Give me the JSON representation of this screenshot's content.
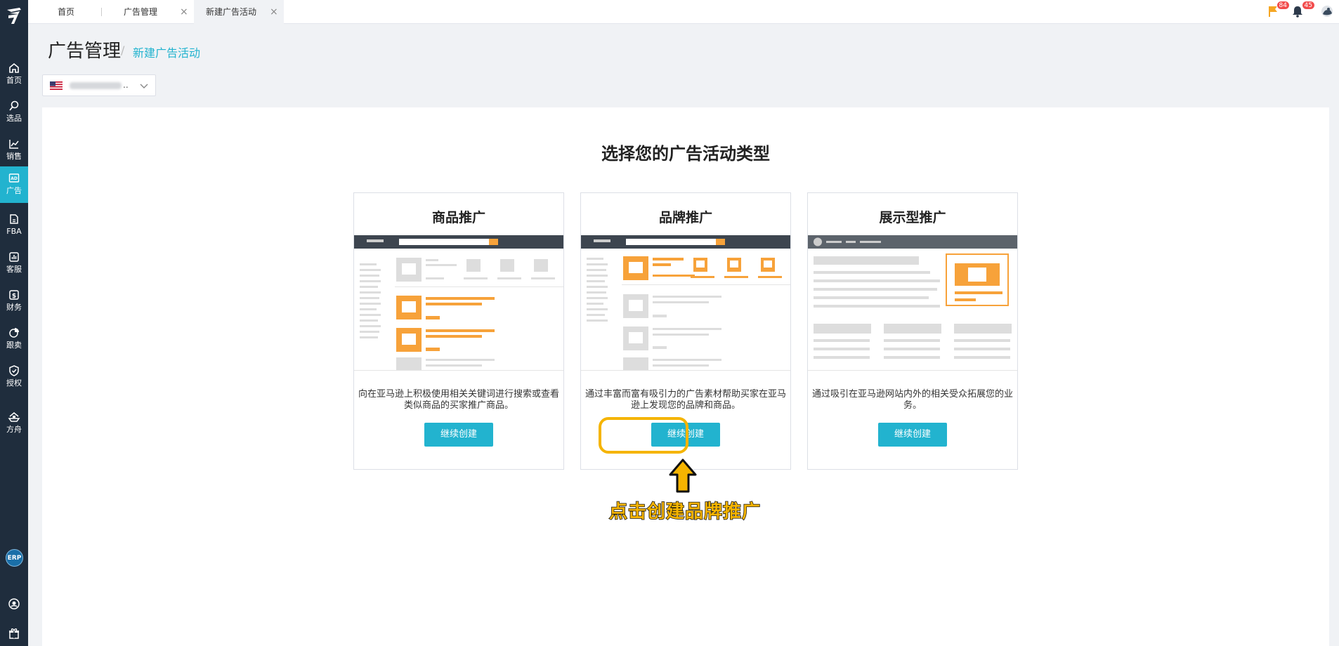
{
  "tabs": {
    "home": "首页",
    "ad_management": "广告管理",
    "new_campaign": "新建广告活动",
    "close_symbol": "×"
  },
  "sidebar": {
    "items": [
      {
        "label": "首页",
        "icon": "home-icon"
      },
      {
        "label": "选品",
        "icon": "search-icon"
      },
      {
        "label": "销售",
        "icon": "trend-chart-icon"
      },
      {
        "label": "广告",
        "icon": "ad-icon",
        "active": true
      },
      {
        "label": "FBA",
        "icon": "fba-icon"
      },
      {
        "label": "客服",
        "icon": "bar-chart-icon"
      },
      {
        "label": "财务",
        "icon": "dollar-icon"
      },
      {
        "label": "跟卖",
        "icon": "pie-chart-icon"
      },
      {
        "label": "授权",
        "icon": "shield-check-icon"
      },
      {
        "label": "方舟",
        "icon": "ark-icon"
      }
    ],
    "erp_label": "ERP"
  },
  "notifications": {
    "flag_count": "84",
    "bell_count": "45"
  },
  "breadcrumb": {
    "title": "广告管理",
    "separator": "/",
    "current": "新建广告活动"
  },
  "store_select": {
    "ellipsis": ".."
  },
  "main": {
    "heading": "选择您的广告活动类型",
    "cards": [
      {
        "title": "商品推广",
        "description": "向在亚马逊上积极使用相关关键词进行搜索或查看类似商品的买家推广商品。",
        "button": "继续创建"
      },
      {
        "title": "品牌推广",
        "description": "通过丰富而富有吸引力的广告素材帮助买家在亚马逊上发现您的品牌和商品。",
        "button": "继续创建"
      },
      {
        "title": "展示型推广",
        "description": "通过吸引在亚马逊网站内外的相关受众拓展您的业务。",
        "button": "继续创建"
      }
    ],
    "callout": "点击创建品牌推广"
  },
  "colors": {
    "sidebar": "#1f2d3d",
    "accent": "#22b3cf",
    "highlight": "#f5b400",
    "illustration_orange": "#f7a23a"
  }
}
